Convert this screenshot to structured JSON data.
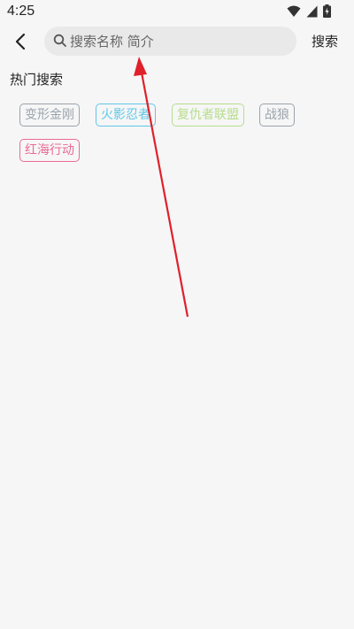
{
  "status_bar": {
    "time": "4:25",
    "icons": [
      "wifi-icon",
      "signal-icon",
      "battery-icon"
    ]
  },
  "header": {
    "back_icon": "back-arrow-icon",
    "search_placeholder": "搜索名称 简介",
    "search_value": "",
    "search_button_label": "搜索"
  },
  "hot_search": {
    "title": "热门搜索",
    "tags": [
      {
        "label": "变形金刚",
        "color": "#9aa3ad"
      },
      {
        "label": "火影忍者",
        "color": "#5fc7e8"
      },
      {
        "label": "复仇者联盟",
        "color": "#b6dd8c"
      },
      {
        "label": "战狼",
        "color": "#9aa3ad"
      },
      {
        "label": "红海行动",
        "color": "#ea6b95"
      }
    ]
  },
  "annotation": {
    "arrow_color": "#e0202b"
  }
}
